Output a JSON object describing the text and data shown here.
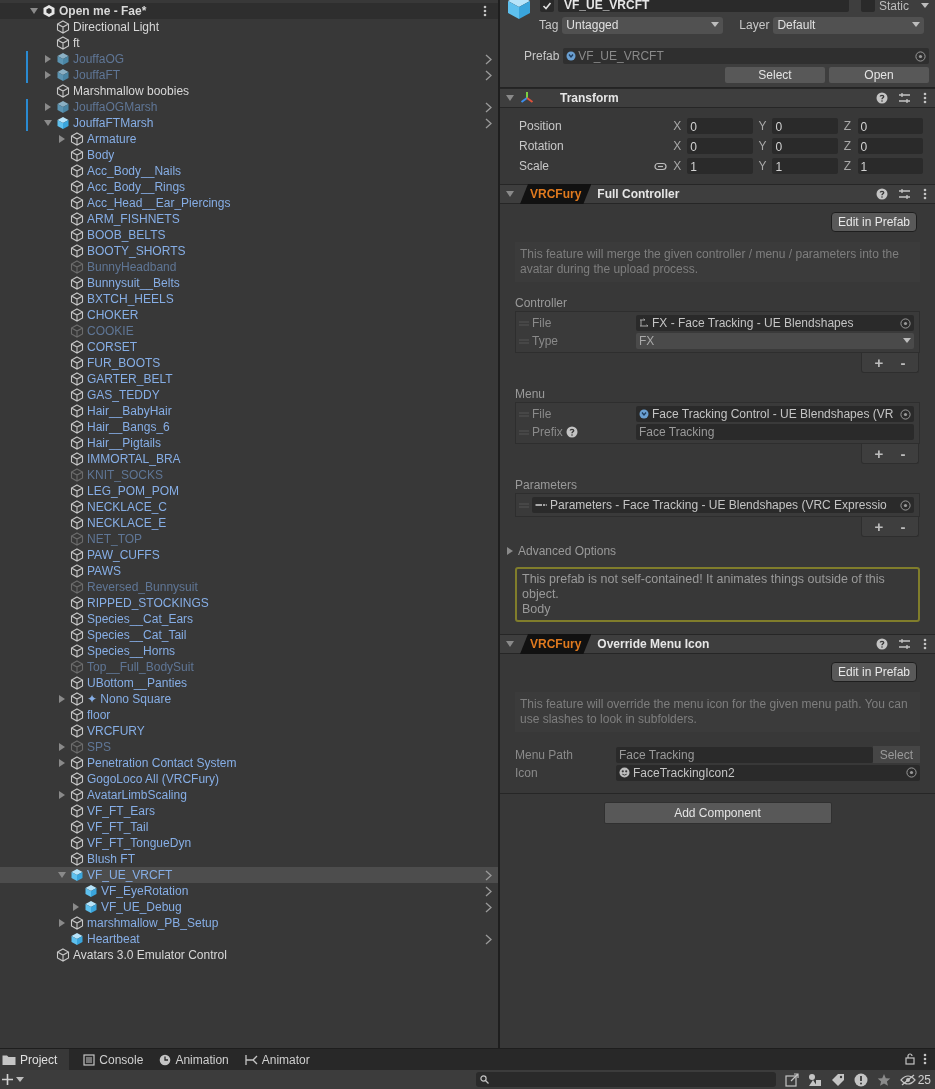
{
  "hierarchy": {
    "root": {
      "label": "Open me - Fae*",
      "kind": "scene",
      "expanded": true,
      "selected": false,
      "children": [
        {
          "label": "Directional Light",
          "kind": "object",
          "active": true,
          "modified": false,
          "selected": false
        },
        {
          "label": "ft",
          "kind": "object",
          "active": true,
          "modified": false,
          "selected": false
        },
        {
          "label": "JouffaOG",
          "kind": "prefab",
          "active": false,
          "modified": true,
          "expanded": false,
          "selected": false
        },
        {
          "label": "JouffaFT",
          "kind": "prefab",
          "active": false,
          "modified": true,
          "expanded": false,
          "selected": false
        },
        {
          "label": "Marshmallow boobies",
          "kind": "object",
          "active": true,
          "modified": false,
          "selected": false
        },
        {
          "label": "JouffaOGMarsh",
          "kind": "prefab",
          "active": false,
          "modified": true,
          "expanded": false,
          "selected": false
        },
        {
          "label": "JouffaFTMarsh",
          "kind": "prefab",
          "active": true,
          "modified": true,
          "expanded": true,
          "selected": false,
          "children": [
            {
              "label": "Armature",
              "kind": "object",
              "active": true,
              "expanded": false,
              "selected": false
            },
            {
              "label": "Body",
              "kind": "object",
              "active": true,
              "selected": false
            },
            {
              "label": "Acc_Body__Nails",
              "kind": "object",
              "active": true,
              "selected": false
            },
            {
              "label": "Acc_Body__Rings",
              "kind": "object",
              "active": true,
              "selected": false
            },
            {
              "label": "Acc_Head__Ear_Piercings",
              "kind": "object",
              "active": true,
              "selected": false
            },
            {
              "label": "ARM_FISHNETS",
              "kind": "object",
              "active": true,
              "selected": false
            },
            {
              "label": "BOOB_BELTS",
              "kind": "object",
              "active": true,
              "selected": false
            },
            {
              "label": "BOOTY_SHORTS",
              "kind": "object",
              "active": true,
              "selected": false
            },
            {
              "label": "BunnyHeadband",
              "kind": "object",
              "active": false,
              "selected": false
            },
            {
              "label": "Bunnysuit__Belts",
              "kind": "object",
              "active": true,
              "selected": false
            },
            {
              "label": "BXTCH_HEELS",
              "kind": "object",
              "active": true,
              "selected": false
            },
            {
              "label": "CHOKER",
              "kind": "object",
              "active": true,
              "selected": false
            },
            {
              "label": "COOKIE",
              "kind": "object",
              "active": false,
              "selected": false
            },
            {
              "label": "CORSET",
              "kind": "object",
              "active": true,
              "selected": false
            },
            {
              "label": "FUR_BOOTS",
              "kind": "object",
              "active": true,
              "selected": false
            },
            {
              "label": "GARTER_BELT",
              "kind": "object",
              "active": true,
              "selected": false
            },
            {
              "label": "GAS_TEDDY",
              "kind": "object",
              "active": true,
              "selected": false
            },
            {
              "label": "Hair__BabyHair",
              "kind": "object",
              "active": true,
              "selected": false
            },
            {
              "label": "Hair__Bangs_6",
              "kind": "object",
              "active": true,
              "selected": false
            },
            {
              "label": "Hair__Pigtails",
              "kind": "object",
              "active": true,
              "selected": false
            },
            {
              "label": "IMMORTAL_BRA",
              "kind": "object",
              "active": true,
              "selected": false
            },
            {
              "label": "KNIT_SOCKS",
              "kind": "object",
              "active": false,
              "selected": false
            },
            {
              "label": "LEG_POM_POM",
              "kind": "object",
              "active": true,
              "selected": false
            },
            {
              "label": "NECKLACE_C",
              "kind": "object",
              "active": true,
              "selected": false
            },
            {
              "label": "NECKLACE_E",
              "kind": "object",
              "active": true,
              "selected": false
            },
            {
              "label": "NET_TOP",
              "kind": "object",
              "active": false,
              "selected": false
            },
            {
              "label": "PAW_CUFFS",
              "kind": "object",
              "active": true,
              "selected": false
            },
            {
              "label": "PAWS",
              "kind": "object",
              "active": true,
              "selected": false
            },
            {
              "label": "Reversed_Bunnysuit",
              "kind": "object",
              "active": false,
              "selected": false
            },
            {
              "label": "RIPPED_STOCKINGS",
              "kind": "object",
              "active": true,
              "selected": false
            },
            {
              "label": "Species__Cat_Ears",
              "kind": "object",
              "active": true,
              "selected": false
            },
            {
              "label": "Species__Cat_Tail",
              "kind": "object",
              "active": true,
              "selected": false
            },
            {
              "label": "Species__Horns",
              "kind": "object",
              "active": true,
              "selected": false
            },
            {
              "label": "Top__Full_BodySuit",
              "kind": "object",
              "active": false,
              "selected": false
            },
            {
              "label": "UBottom__Panties",
              "kind": "object",
              "active": true,
              "selected": false
            },
            {
              "label": "✦ Nono Square",
              "kind": "object",
              "active": true,
              "expanded": false,
              "selected": false
            },
            {
              "label": "floor",
              "kind": "object",
              "active": true,
              "selected": false
            },
            {
              "label": "VRCFURY",
              "kind": "object",
              "active": true,
              "selected": false
            },
            {
              "label": "SPS",
              "kind": "object",
              "active": false,
              "expanded": false,
              "selected": false
            },
            {
              "label": "Penetration Contact System",
              "kind": "object",
              "active": true,
              "expanded": false,
              "selected": false
            },
            {
              "label": "GogoLoco All (VRCFury)",
              "kind": "object",
              "active": true,
              "selected": false
            },
            {
              "label": "AvatarLimbScaling",
              "kind": "object",
              "active": true,
              "expanded": false,
              "selected": false
            },
            {
              "label": "VF_FT_Ears",
              "kind": "object",
              "active": true,
              "selected": false
            },
            {
              "label": "VF_FT_Tail",
              "kind": "object",
              "active": true,
              "selected": false
            },
            {
              "label": "VF_FT_TongueDyn",
              "kind": "object",
              "active": true,
              "selected": false
            },
            {
              "label": "Blush FT",
              "kind": "object",
              "active": true,
              "selected": false
            },
            {
              "label": "VF_UE_VRCFT",
              "kind": "prefab",
              "active": true,
              "expanded": true,
              "selected": true,
              "children": [
                {
                  "label": "VF_EyeRotation",
                  "kind": "prefab",
                  "active": true,
                  "selected": false
                },
                {
                  "label": "VF_UE_Debug",
                  "kind": "prefab",
                  "active": true,
                  "expanded": false,
                  "selected": false
                }
              ]
            },
            {
              "label": "marshmallow_PB_Setup",
              "kind": "object",
              "active": true,
              "expanded": false,
              "selected": false
            },
            {
              "label": "Heartbeat",
              "kind": "prefab",
              "active": true,
              "selected": false
            }
          ]
        },
        {
          "label": "Avatars 3.0 Emulator Control",
          "kind": "object",
          "active": true,
          "modified": false,
          "selected": false
        }
      ]
    }
  },
  "inspector": {
    "object_name": "VF_UE_VRCFT",
    "enabled": true,
    "static_label": "Static",
    "static": false,
    "tag_label": "Tag",
    "tag": "Untagged",
    "layer_label": "Layer",
    "layer": "Default",
    "prefab_label": "Prefab",
    "prefab": "VF_UE_VRCFT",
    "prefab_buttons": [
      "Select",
      "Open"
    ],
    "components": [
      {
        "kind": "transform",
        "title": "Transform",
        "expanded": true,
        "rows": [
          {
            "label": "Position",
            "linked": false,
            "values": [
              {
                "axis": "X",
                "value": "0"
              },
              {
                "axis": "Y",
                "value": "0"
              },
              {
                "axis": "Z",
                "value": "0"
              }
            ]
          },
          {
            "label": "Rotation",
            "linked": false,
            "values": [
              {
                "axis": "X",
                "value": "0"
              },
              {
                "axis": "Y",
                "value": "0"
              },
              {
                "axis": "Z",
                "value": "0"
              }
            ]
          },
          {
            "label": "Scale",
            "linked": true,
            "values": [
              {
                "axis": "X",
                "value": "1"
              },
              {
                "axis": "Y",
                "value": "1"
              },
              {
                "axis": "Z",
                "value": "1"
              }
            ]
          }
        ]
      },
      {
        "kind": "vrcfury",
        "badge": "VRCFury",
        "title": "Full Controller",
        "expanded": true,
        "edit_button": "Edit in Prefab",
        "description": "This feature will merge the given controller / menu / parameters into the avatar during the upload process.",
        "groups": [
          {
            "title": "Controller",
            "buttons": [
              "+",
              "-"
            ],
            "fields": [
              {
                "label": "File",
                "kind": "object",
                "value": "FX - Face Tracking - UE Blendshapes"
              },
              {
                "label": "Type",
                "kind": "dropdown",
                "value": "FX"
              }
            ]
          },
          {
            "title": "Menu",
            "buttons": [
              "+",
              "-"
            ],
            "fields": [
              {
                "label": "File",
                "kind": "object",
                "value": "Face Tracking Control - UE Blendshapes (VR"
              },
              {
                "label": "Prefix",
                "kind": "text",
                "help": true,
                "value": "Face Tracking"
              }
            ]
          },
          {
            "title": "Parameters",
            "buttons": [
              "+",
              "-"
            ],
            "fields": [
              {
                "kind": "object",
                "value": "Parameters - Face Tracking - UE Blendshapes (VRC Expressio"
              }
            ]
          }
        ],
        "foldout": {
          "label": "Advanced Options",
          "expanded": false
        },
        "warning": [
          "This prefab is not self-contained! It animates things outside of this object.",
          "Body"
        ]
      },
      {
        "kind": "vrcfury",
        "badge": "VRCFury",
        "title": "Override Menu Icon",
        "expanded": true,
        "edit_button": "Edit in Prefab",
        "description": "This feature will override the menu icon for the given menu path. You can use slashes to look in subfolders.",
        "fields": [
          {
            "label": "Menu Path",
            "kind": "text",
            "value": "Face Tracking",
            "button": "Select"
          },
          {
            "label": "Icon",
            "kind": "object",
            "value": "FaceTrackingIcon2"
          }
        ]
      }
    ],
    "add_component": "Add Component"
  },
  "bottom_panel": {
    "tabs": [
      {
        "label": "Project",
        "selected": true
      },
      {
        "label": "Console",
        "selected": false
      },
      {
        "label": "Animation",
        "selected": false
      },
      {
        "label": "Animator",
        "selected": false
      }
    ],
    "hidden_count": "25"
  }
}
